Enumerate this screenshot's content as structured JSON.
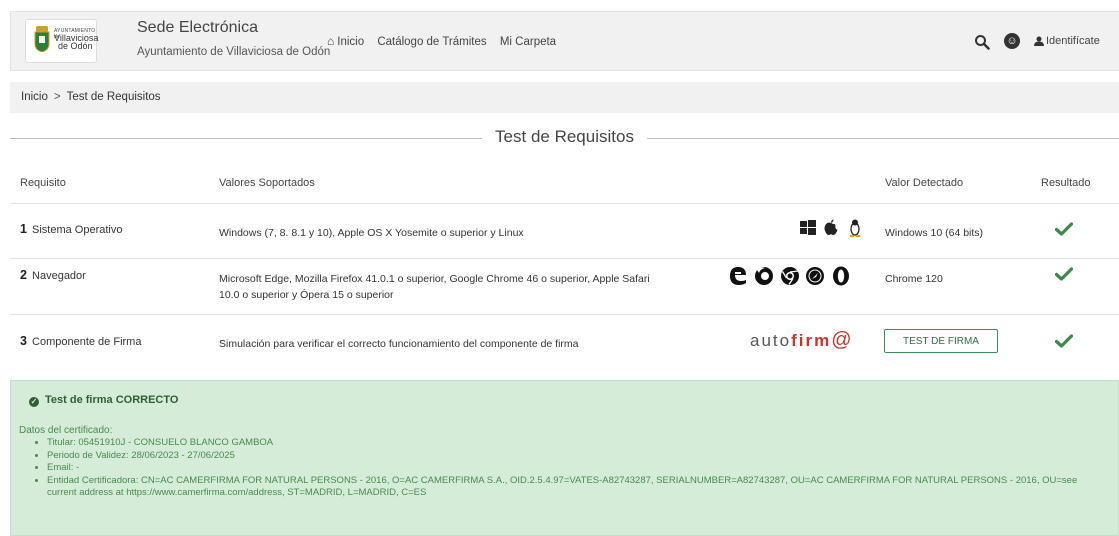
{
  "header": {
    "logo_small": "AYUNTAMIENTO de",
    "logo_name1": "Villaviciosa",
    "logo_name2": "de Odón",
    "title": "Sede Electrónica",
    "subtitle": "Ayuntamiento de Villaviciosa de Odón",
    "nav": [
      "Inicio",
      "Catálogo de Trámites",
      "Mi Carpeta"
    ],
    "login_label": "Identifícate"
  },
  "breadcrumb": {
    "home": "Inicio",
    "separator": ">",
    "current": "Test de Requisitos"
  },
  "page_title": "Test de Requisitos",
  "table": {
    "headers": [
      "Requisito",
      "Valores Soportados",
      "Valor Detectado",
      "Resultado"
    ],
    "rows": [
      {
        "num": "1",
        "name": "Sistema Operativo",
        "supported": "Windows (7, 8. 8.1 y 10), Apple OS X Yosemite o superior y Linux",
        "detected": "Windows 10 (64 bits)"
      },
      {
        "num": "2",
        "name": "Navegador",
        "supported": "Microsoft Edge, Mozilla Firefox 41.0.1 o superior, Google Chrome 46 o superior, Apple Safari 10.0 o superior y Ópera 15 o superior",
        "detected": "Chrome 120"
      },
      {
        "num": "3",
        "name": "Componente de Firma",
        "supported": "Simulación para verificar el correcto funcionamiento del componente de firma",
        "detected_button": "TEST DE FIRMA"
      }
    ],
    "autofirma_logo": {
      "prefix": "auto",
      "bold": "firm",
      "suffix": "@"
    }
  },
  "result": {
    "title": "Test de firma CORRECTO",
    "cert_label": "Datos del certificado:",
    "items": [
      "Titular: 05451910J - CONSUELO BLANCO GAMBOA",
      "Periodo de Validez: 28/06/2023 - 27/06/2025",
      "Email: -",
      "Entidad Certificadora: CN=AC CAMERFIRMA FOR NATURAL PERSONS - 2016, O=AC CAMERFIRMA S.A., OID.2.5.4.97=VATES-A82743287, SERIALNUMBER=A82743287, OU=AC CAMERFIRMA FOR NATURAL PERSONS - 2016, OU=see current address at https://www.camerfirma.com/address, ST=MADRID, L=MADRID, C=ES"
    ]
  },
  "colors": {
    "check": "#3a8a4a",
    "result_bg": "#d5ecd9",
    "result_text": "#4a8a4c",
    "header_bg": "#f1f1f1"
  },
  "icons": [
    "search-icon",
    "accessibility-icon",
    "user-icon",
    "home-icon",
    "windows-icon",
    "apple-icon",
    "linux-icon",
    "edge-icon",
    "firefox-icon",
    "chrome-icon",
    "safari-icon",
    "opera-icon",
    "check-icon"
  ]
}
